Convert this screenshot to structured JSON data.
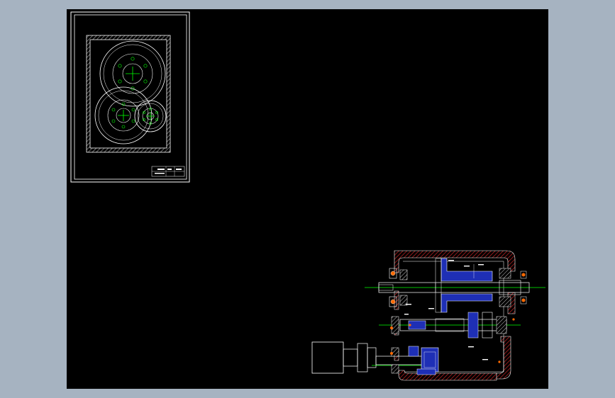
{
  "colors": {
    "background": "#000000",
    "frame": "#a6b3c1",
    "line": "#ffffff",
    "center_mark": "#00ff00",
    "section_hatch": "#8b1a1a",
    "part_fill": "#1e2fb5",
    "title_block": "#ffffff"
  },
  "icons": {
    "gear_symbol": "concentric-circles",
    "center_cross": "plus-mark"
  }
}
